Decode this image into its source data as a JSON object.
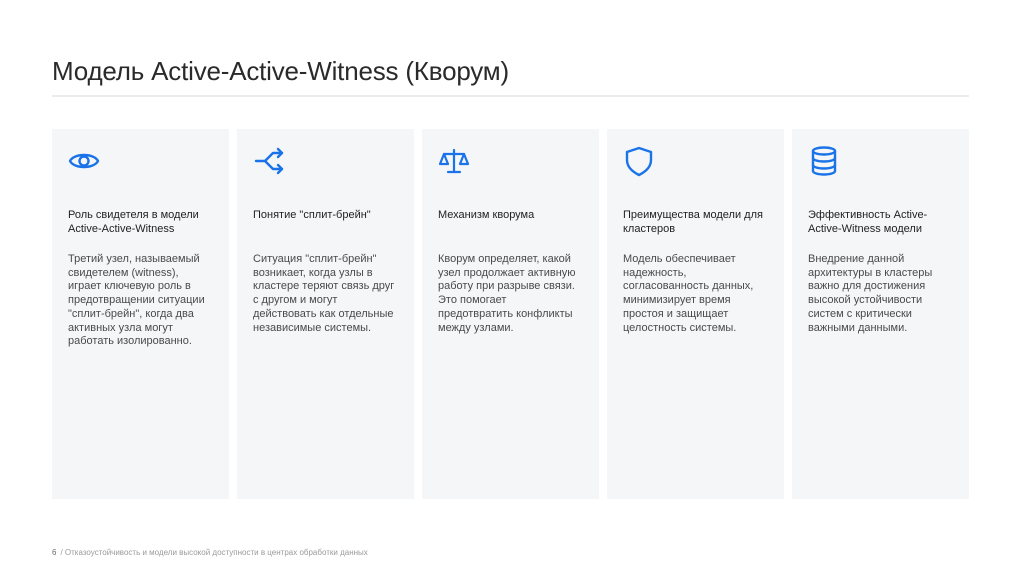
{
  "slide": {
    "title": "Модель Active-Active-Witness (Кворум)"
  },
  "accent_color": "#1a73e8",
  "cards": [
    {
      "icon": "eye-icon",
      "title": "Роль свидетеля в модели Active-Active-Witness",
      "body": "Третий узел, называемый свидетелем (witness), играет ключевую роль в предотвращении ситуации \"сплит-брейн\", когда два активных узла могут работать изолированно."
    },
    {
      "icon": "split-arrows-icon",
      "title": "Понятие \"сплит-брейн\"",
      "body": "Ситуация \"сплит-брейн\" возникает, когда узлы в кластере теряют связь друг с другом и могут действовать как отдельные независимые системы."
    },
    {
      "icon": "scales-icon",
      "title": "Механизм кворума",
      "body": "Кворум определяет, какой узел продолжает активную работу при разрыве связи. Это помогает предотвратить конфликты между узлами."
    },
    {
      "icon": "shield-icon",
      "title": "Преимущества модели для кластеров",
      "body": "Модель обеспечивает надежность, согласованность данных, минимизирует время простоя и защищает целостность системы."
    },
    {
      "icon": "database-icon",
      "title": "Эффективность Active-Active-Witness модели",
      "body": "Внедрение данной архитектуры в кластеры важно для достижения высокой устойчивости систем с критически важными данными."
    }
  ],
  "footer": {
    "page_number": "6",
    "text": "/ Отказоустойчивость и модели высокой доступности в центрах обработки данных"
  }
}
